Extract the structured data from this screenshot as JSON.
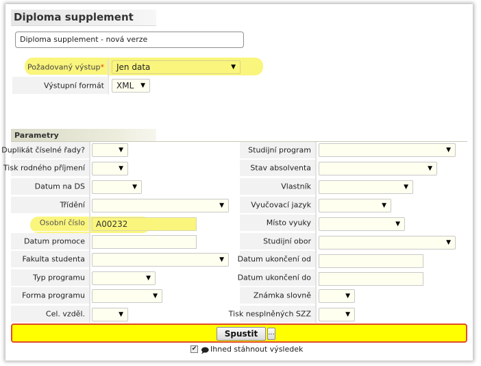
{
  "page": {
    "title": "Diploma supplement",
    "version_label": "Diploma supplement - nová verze"
  },
  "output": {
    "requested_label": "Požadovaný výstup",
    "required_mark": "*",
    "requested_value": "Jen data",
    "format_label": "Výstupní formát",
    "format_value": "XML"
  },
  "params": {
    "heading": "Parametry",
    "left": [
      {
        "label": "Duplikát číselné řady?",
        "value": ""
      },
      {
        "label": "Tisk rodného příjmení",
        "value": ""
      },
      {
        "label": "Datum na DS",
        "value": ""
      },
      {
        "label": "Třídění",
        "value": ""
      },
      {
        "label": "Osobní číslo",
        "value": "A00232"
      },
      {
        "label": "Datum promoce",
        "value": ""
      },
      {
        "label": "Fakulta studenta",
        "value": ""
      },
      {
        "label": "Typ programu",
        "value": ""
      },
      {
        "label": "Forma programu",
        "value": ""
      },
      {
        "label": "Cel. vzděl.",
        "value": ""
      }
    ],
    "right": [
      {
        "label": "Studijní program",
        "value": ""
      },
      {
        "label": "Stav absolventa",
        "value": ""
      },
      {
        "label": "Vlastník",
        "value": ""
      },
      {
        "label": "Vyučovací jazyk",
        "value": ""
      },
      {
        "label": "Místo vyuky",
        "value": ""
      },
      {
        "label": "Studijní obor",
        "value": ""
      },
      {
        "label": "Datum ukončení od",
        "value": ""
      },
      {
        "label": "Datum ukončení do",
        "value": ""
      },
      {
        "label": "Známka slovně",
        "value": ""
      },
      {
        "label": "Tisk nesplněných SZZ",
        "value": ""
      }
    ]
  },
  "actions": {
    "run_label": "Spustit",
    "more_label": "...",
    "download_checked": "✔",
    "download_icon": "🗩",
    "download_label": "Ihned stáhnout výsledek"
  },
  "icons": {
    "dropdown_arrow": "▼"
  },
  "colors": {
    "highlight": "#faf57c",
    "run_bar": "#ffff00",
    "run_bar_border": "#e24a2a",
    "field_bg": "#fffff0"
  }
}
